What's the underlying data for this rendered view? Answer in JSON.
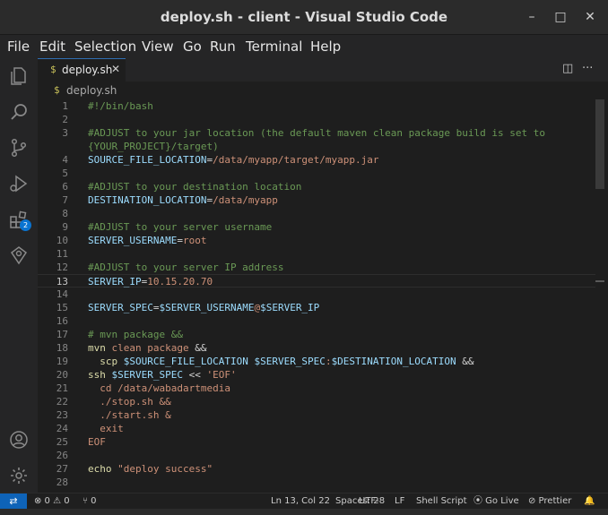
{
  "window": {
    "title": "deploy.sh - client - Visual Studio Code",
    "minimize": "–",
    "maximize": "□",
    "close": "✕"
  },
  "menu": [
    "File",
    "Edit",
    "Selection",
    "View",
    "Go",
    "Run",
    "Terminal",
    "Help"
  ],
  "activity": {
    "extensions_badge": "2"
  },
  "tab": {
    "icon": "$",
    "label": "deploy.sh",
    "close": "✕",
    "split": "◫",
    "more": "···"
  },
  "breadcrumb": {
    "icon": "$",
    "label": "deploy.sh"
  },
  "code_lines": [
    {
      "n": "1",
      "tokens": [
        {
          "t": "#!/bin/bash",
          "c": "comment"
        }
      ]
    },
    {
      "n": "2",
      "tokens": []
    },
    {
      "n": "3",
      "tokens": [
        {
          "t": "#ADJUST to your jar location (the default maven clean package build is set to",
          "c": "comment"
        }
      ]
    },
    {
      "n": "",
      "tokens": [
        {
          "t": "{YOUR_PROJECT}/target)",
          "c": "comment"
        }
      ]
    },
    {
      "n": "4",
      "tokens": [
        {
          "t": "SOURCE_FILE_LOCATION",
          "c": "var"
        },
        {
          "t": "=",
          "c": "op"
        },
        {
          "t": "/data/myapp/target/myapp.jar",
          "c": "str"
        }
      ]
    },
    {
      "n": "5",
      "tokens": []
    },
    {
      "n": "6",
      "tokens": [
        {
          "t": "#ADJUST to your destination location",
          "c": "comment"
        }
      ]
    },
    {
      "n": "7",
      "tokens": [
        {
          "t": "DESTINATION_LOCATION",
          "c": "var"
        },
        {
          "t": "=",
          "c": "op"
        },
        {
          "t": "/data/myapp",
          "c": "str"
        }
      ]
    },
    {
      "n": "8",
      "tokens": []
    },
    {
      "n": "9",
      "tokens": [
        {
          "t": "#ADJUST to your server username",
          "c": "comment"
        }
      ]
    },
    {
      "n": "10",
      "tokens": [
        {
          "t": "SERVER_USERNAME",
          "c": "var"
        },
        {
          "t": "=",
          "c": "op"
        },
        {
          "t": "root",
          "c": "str"
        }
      ]
    },
    {
      "n": "11",
      "tokens": []
    },
    {
      "n": "12",
      "tokens": [
        {
          "t": "#ADJUST to your server IP address",
          "c": "comment"
        }
      ]
    },
    {
      "n": "13",
      "tokens": [
        {
          "t": "SERVER_IP",
          "c": "var"
        },
        {
          "t": "=",
          "c": "op"
        },
        {
          "t": "10.15.20.70",
          "c": "str"
        }
      ],
      "current": true
    },
    {
      "n": "14",
      "tokens": []
    },
    {
      "n": "15",
      "tokens": [
        {
          "t": "SERVER_SPEC",
          "c": "var"
        },
        {
          "t": "=",
          "c": "op"
        },
        {
          "t": "$SERVER_USERNAME",
          "c": "var"
        },
        {
          "t": "@",
          "c": "str"
        },
        {
          "t": "$SERVER_IP",
          "c": "var"
        }
      ]
    },
    {
      "n": "16",
      "tokens": []
    },
    {
      "n": "17",
      "tokens": [
        {
          "t": "# mvn package &&",
          "c": "comment"
        }
      ]
    },
    {
      "n": "18",
      "tokens": [
        {
          "t": "mvn ",
          "c": "kw"
        },
        {
          "t": "clean package ",
          "c": "str"
        },
        {
          "t": "&&",
          "c": "op"
        }
      ]
    },
    {
      "n": "19",
      "tokens": [
        {
          "t": "  scp ",
          "c": "kw"
        },
        {
          "t": "$SOURCE_FILE_LOCATION",
          "c": "var"
        },
        {
          "t": " ",
          "c": "op"
        },
        {
          "t": "$SERVER_SPEC",
          "c": "var"
        },
        {
          "t": ":",
          "c": "str"
        },
        {
          "t": "$DESTINATION_LOCATION",
          "c": "var"
        },
        {
          "t": " &&",
          "c": "op"
        }
      ]
    },
    {
      "n": "20",
      "tokens": [
        {
          "t": "ssh ",
          "c": "kw"
        },
        {
          "t": "$SERVER_SPEC",
          "c": "var"
        },
        {
          "t": " << ",
          "c": "op"
        },
        {
          "t": "'EOF'",
          "c": "str"
        }
      ]
    },
    {
      "n": "21",
      "tokens": [
        {
          "t": "  cd /data/wabadartmedia",
          "c": "str"
        }
      ]
    },
    {
      "n": "22",
      "tokens": [
        {
          "t": "  ./stop.sh &&",
          "c": "str"
        }
      ]
    },
    {
      "n": "23",
      "tokens": [
        {
          "t": "  ./start.sh &",
          "c": "str"
        }
      ]
    },
    {
      "n": "24",
      "tokens": [
        {
          "t": "  exit",
          "c": "str"
        }
      ]
    },
    {
      "n": "25",
      "tokens": [
        {
          "t": "EOF",
          "c": "str"
        }
      ]
    },
    {
      "n": "26",
      "tokens": []
    },
    {
      "n": "27",
      "tokens": [
        {
          "t": "echo ",
          "c": "kw"
        },
        {
          "t": "\"deploy success\"",
          "c": "str"
        }
      ]
    },
    {
      "n": "28",
      "tokens": []
    }
  ],
  "status": {
    "remote": "⇄",
    "problems": "⊗ 0 ⚠ 0",
    "ports": "⑂ 0",
    "cursor": "Ln 13, Col 22",
    "spaces": "Spaces: 2",
    "encoding": "UTF-8",
    "eol": "LF",
    "language": "Shell Script",
    "golive": "⦿ Go Live",
    "prettier": "⊘ Prettier",
    "bell": "🔔"
  },
  "colors": {
    "accent": "#0e63b8",
    "comment": "#6a9955",
    "variable": "#9cdcfe",
    "string": "#ce9178",
    "command": "#dcdcaa"
  }
}
